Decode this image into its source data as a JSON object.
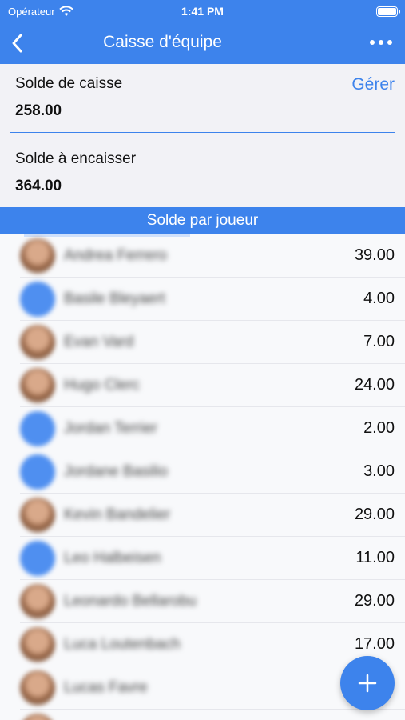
{
  "status": {
    "carrier": "Opérateur",
    "time": "1:41 PM"
  },
  "nav": {
    "title": "Caisse d'équipe"
  },
  "balance": {
    "cash_label": "Solde de caisse",
    "cash_value": "258.00",
    "manage_label": "Gérer",
    "due_label": "Solde à encaisser",
    "due_value": "364.00"
  },
  "section_title": "Solde par joueur",
  "players": [
    {
      "name": "Andrea Ferrero",
      "amount": "39.00",
      "avatar": "photo"
    },
    {
      "name": "Basile Bleyaert",
      "amount": "4.00",
      "avatar": "default"
    },
    {
      "name": "Evan Vard",
      "amount": "7.00",
      "avatar": "photo"
    },
    {
      "name": "Hugo Clerc",
      "amount": "24.00",
      "avatar": "photo"
    },
    {
      "name": "Jordan Terrier",
      "amount": "2.00",
      "avatar": "default"
    },
    {
      "name": "Jordane Basilio",
      "amount": "3.00",
      "avatar": "default"
    },
    {
      "name": "Kevin Bandelier",
      "amount": "29.00",
      "avatar": "photo"
    },
    {
      "name": "Leo Halbeisen",
      "amount": "11.00",
      "avatar": "default"
    },
    {
      "name": "Leonardo Bellarobu",
      "amount": "29.00",
      "avatar": "photo"
    },
    {
      "name": "Luca Loutenbach",
      "amount": "17.00",
      "avatar": "photo"
    },
    {
      "name": "Lucas Favre",
      "amount": "",
      "avatar": "photo"
    },
    {
      "name": "",
      "amount": "",
      "avatar": "photo"
    }
  ],
  "colors": {
    "accent": "#3d83ec"
  },
  "icons": {
    "back": "chevron-left-icon",
    "more": "more-horizontal-icon",
    "add": "plus-icon"
  }
}
